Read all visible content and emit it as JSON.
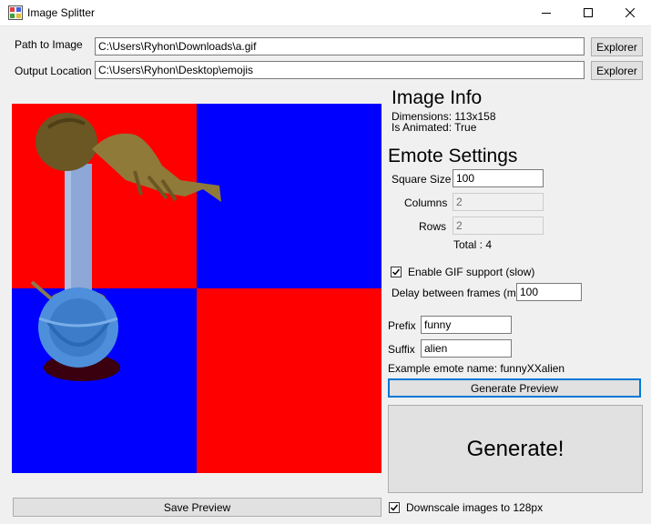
{
  "window": {
    "title": "Image Splitter",
    "icon": "app-icon",
    "controls": [
      "minimize-icon",
      "maximize-icon",
      "close-icon"
    ]
  },
  "paths": {
    "image_label": "Path to Image",
    "image_value": "C:\\Users\\Ryhon\\Downloads\\a.gif",
    "image_button": "Explorer",
    "output_label": "Output Location",
    "output_value": "C:\\Users\\Ryhon\\Desktop\\emojis",
    "output_button": "Explorer"
  },
  "preview": {
    "grid_colors": [
      "#ff0000",
      "#0000ff",
      "#0000ff",
      "#ff0000"
    ],
    "save_button": "Save Preview"
  },
  "image_info": {
    "heading": "Image Info",
    "dimensions": "Dimensions: 113x158",
    "animated": "Is Animated: True"
  },
  "emote_settings": {
    "heading": "Emote Settings",
    "square_size_label": "Square Size",
    "square_size_value": "100",
    "columns_label": "Columns",
    "columns_value": "2",
    "rows_label": "Rows",
    "rows_value": "2",
    "total": "Total : 4"
  },
  "gif": {
    "enable_label": "Enable GIF support (slow)",
    "enable_checked": true,
    "delay_label": "Delay between frames (ms)",
    "delay_value": "100"
  },
  "naming": {
    "prefix_label": "Prefix",
    "prefix_value": "funny",
    "suffix_label": "Suffix",
    "suffix_value": "alien",
    "example": "Example emote name: funnyXXalien"
  },
  "actions": {
    "generate_preview": "Generate Preview",
    "generate": "Generate!",
    "downscale_label": "Downscale images to 128px",
    "downscale_checked": true
  }
}
